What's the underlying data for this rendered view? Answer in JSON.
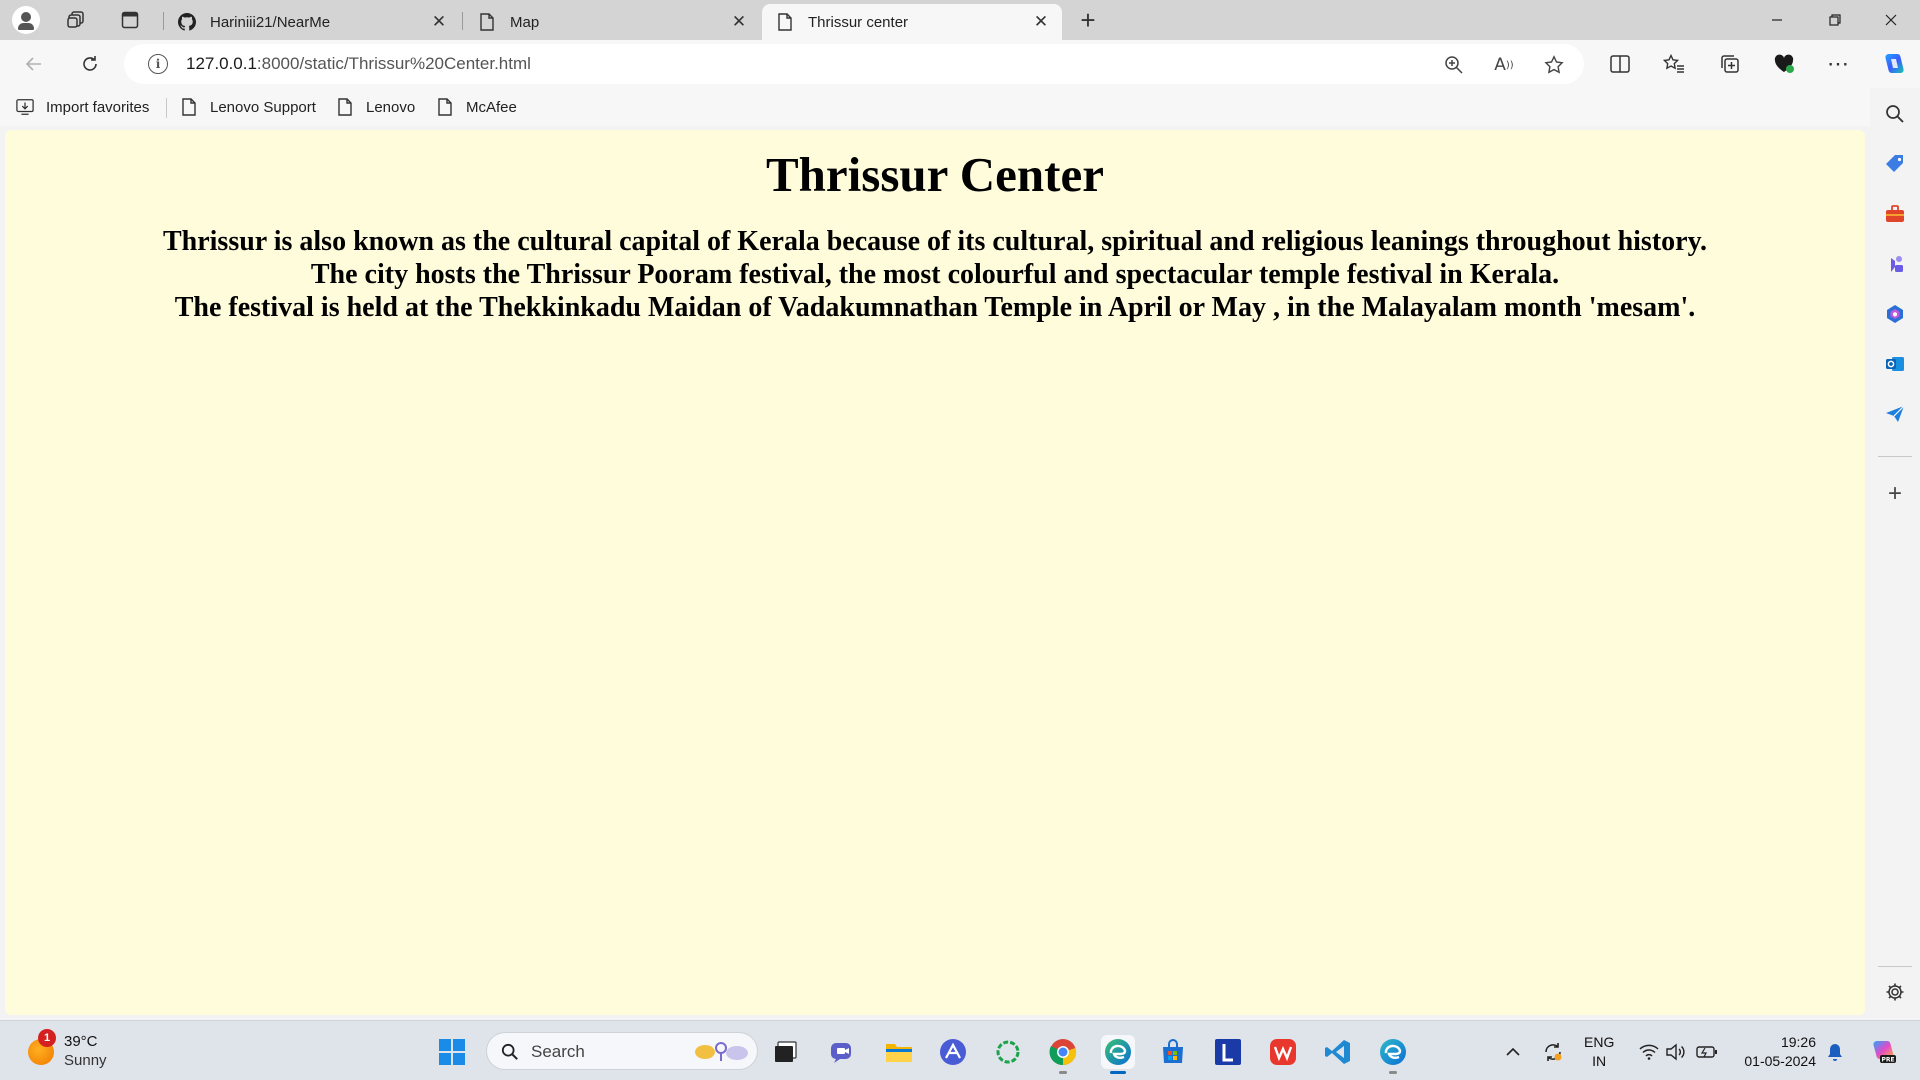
{
  "browser": {
    "tabs": [
      {
        "title": "Hariniii21/NearMe",
        "favicon": "github-icon"
      },
      {
        "title": "Map",
        "favicon": "page-icon"
      },
      {
        "title": "Thrissur center",
        "favicon": "page-icon",
        "active": true
      }
    ],
    "address": {
      "host": "127.0.0.1",
      "rest": ":8000/static/Thrissur%20Center.html"
    },
    "favorites": [
      {
        "label": "Import favorites",
        "icon": "import-icon"
      },
      {
        "label": "Lenovo Support",
        "icon": "page-icon"
      },
      {
        "label": "Lenovo",
        "icon": "page-icon"
      },
      {
        "label": "McAfee",
        "icon": "page-icon"
      }
    ]
  },
  "page": {
    "title": "Thrissur Center",
    "lines": [
      "Thrissur is also known as the cultural capital of Kerala because of its cultural, spiritual and religious leanings throughout history.",
      "The city hosts the Thrissur Pooram festival, the most colourful and spectacular temple festival in Kerala.",
      "The festival is held at the Thekkinkadu Maidan of Vadakumnathan Temple in April or May , in the Malayalam month 'mesam'."
    ],
    "background": "#fffcdc"
  },
  "taskbar": {
    "weather": {
      "temp": "39°C",
      "condition": "Sunny",
      "badge": "1"
    },
    "search_placeholder": "Search",
    "lang_line1": "ENG",
    "lang_line2": "IN",
    "time": "19:26",
    "date": "01-05-2024"
  },
  "colors": {
    "accent": "#0067c0",
    "page_bg": "#fffcdc"
  }
}
